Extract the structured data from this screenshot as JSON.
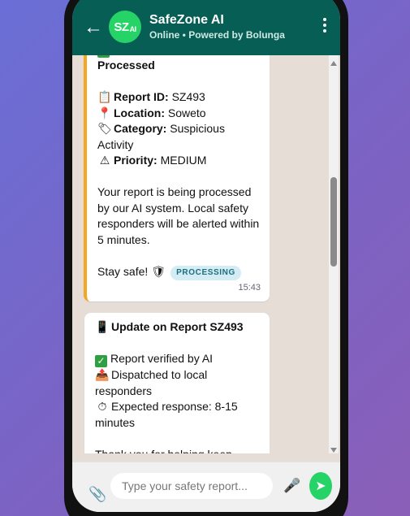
{
  "header": {
    "back_icon": "arrow-left-icon",
    "avatar_text": "SZ",
    "avatar_sub": "AI",
    "title": "SafeZone AI",
    "status": "Online • Powered by Bolunga",
    "menu_icon": "more-vertical-icon"
  },
  "messages": [
    {
      "heading": "Report Received & Processed",
      "report_id_label": "Report ID:",
      "report_id": "SZ493",
      "location_label": "Location:",
      "location": "Soweto",
      "category_label": "Category:",
      "category": "Suspicious Activity",
      "priority_label": "Priority:",
      "priority": "MEDIUM",
      "body": "Your report is being processed by our AI system. Local safety responders will be alerted within 5 minutes.",
      "signoff": "Stay safe!",
      "badge": "PROCESSING",
      "time": "15:43",
      "accent_color": "#f5a623"
    },
    {
      "heading": "Update on Report SZ493",
      "line1": "Report verified by AI",
      "line2": "Dispatched to local responders",
      "line3": "Expected response: 8-15 minutes",
      "line4": "Thank you for helping keep"
    }
  ],
  "composer": {
    "attach_icon": "paperclip-icon",
    "placeholder": "Type your safety report...",
    "mic_icon": "microphone-icon",
    "send_icon": "send-icon"
  },
  "colors": {
    "header_bg": "#075e54",
    "chat_bg": "#e6ddd6",
    "send_button": "#25d366",
    "badge_bg": "#d4ecf3"
  }
}
